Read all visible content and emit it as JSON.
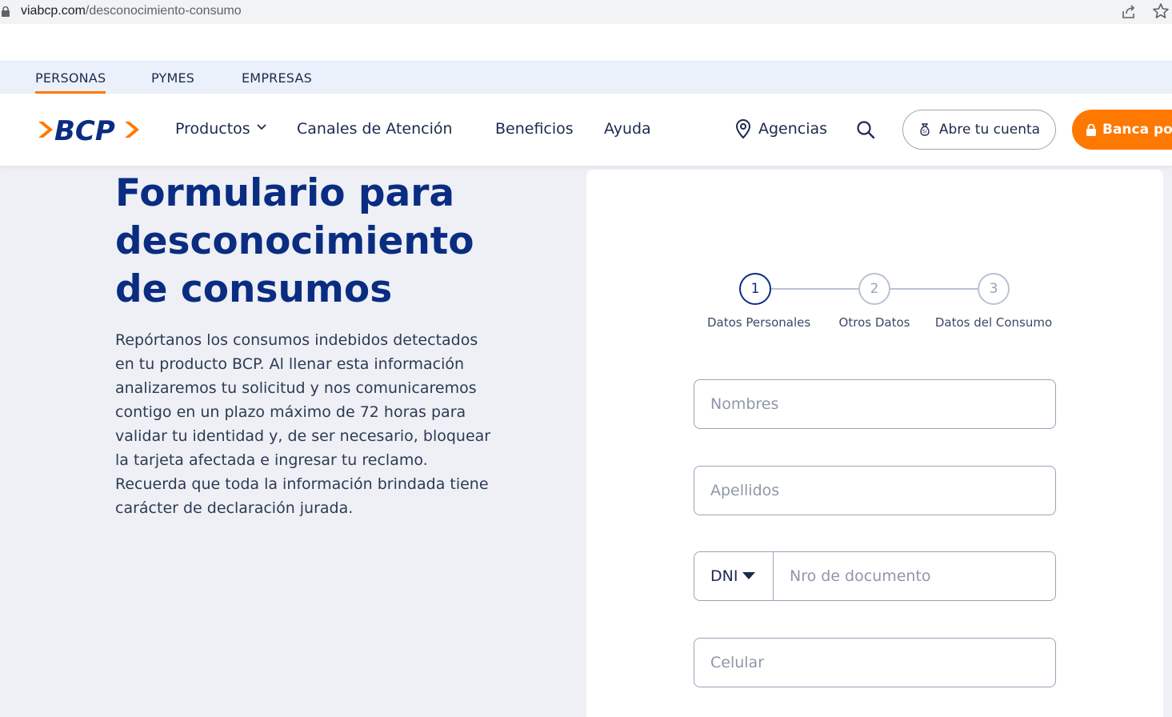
{
  "browser": {
    "url_host": "viabcp.com",
    "url_path": "/desconocimiento-consumo"
  },
  "segments": [
    {
      "label": "PERSONAS",
      "active": true
    },
    {
      "label": "PYMES",
      "active": false
    },
    {
      "label": "EMPRESAS",
      "active": false
    }
  ],
  "nav": {
    "logo_text": "BCP",
    "items": [
      "Productos",
      "Canales de Atención",
      "Beneficios",
      "Ayuda"
    ],
    "agencias": "Agencias",
    "abre_cuenta": "Abre tu cuenta",
    "banca": "Banca por",
    "colors": {
      "brand_blue": "#0a2d82",
      "brand_orange": "#ff7800"
    }
  },
  "hero": {
    "title_line1": "Formulario para",
    "title_line2": "desconocimiento",
    "title_line3": "de consumos",
    "description": "Repórtanos los consumos indebidos detectados en tu producto BCP. Al llenar esta información analizaremos tu solicitud y nos comunicaremos contigo en un plazo máximo de 72 horas para validar tu identidad y, de ser necesario, bloquear la tarjeta afectada e ingresar tu reclamo. Recuerda que toda la información brindada tiene carácter de declaración jurada."
  },
  "form": {
    "steps": [
      {
        "number": "1",
        "label": "Datos Personales",
        "active": true
      },
      {
        "number": "2",
        "label": "Otros Datos",
        "active": false
      },
      {
        "number": "3",
        "label": "Datos del Consumo",
        "active": false
      }
    ],
    "nombres_placeholder": "Nombres",
    "apellidos_placeholder": "Apellidos",
    "doc_type": "DNI",
    "doc_placeholder": "Nro de documento",
    "celular_placeholder": "Celular"
  }
}
